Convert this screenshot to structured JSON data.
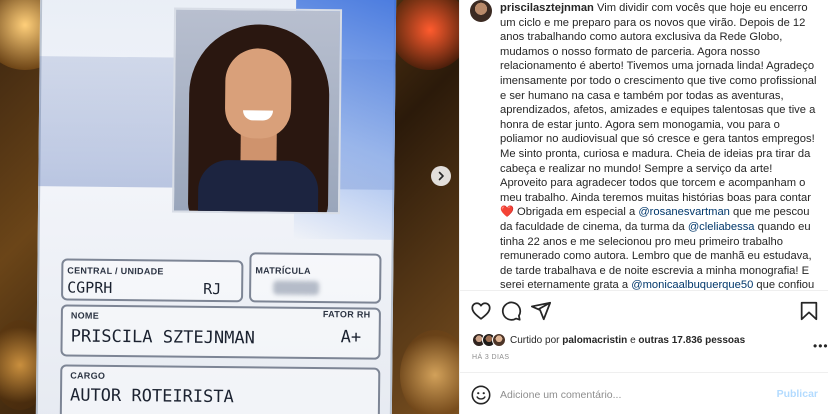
{
  "card": {
    "label_central": "CENTRAL / UNIDADE",
    "label_matricula": "MATRÍCULA",
    "value_central": "CGPRH",
    "value_state": "RJ",
    "label_nome": "NOME",
    "label_fator": "FATOR RH",
    "value_nome": "PRISCILA SZTEJNMAN",
    "value_fator": "A+",
    "label_cargo": "CARGO",
    "value_cargo": "AUTOR ROTEIRISTA"
  },
  "post": {
    "username": "priscilasztejnman",
    "caption_parts": {
      "p1": " Vim dividir com vocês que hoje eu encerro um ciclo e me preparo para os novos que virão. Depois de 12 anos trabalhando como autora exclusiva da Rede Globo, mudamos o nosso formato de parceria. Agora nosso relacionamento é aberto! Tivemos uma jornada linda! Agradeço imensamente por todo o crescimento que tive como profissional e ser humano na casa e também por todas as aventuras, aprendizados, afetos, amizades e equipes talentosas que tive a honra de estar junto. Agora sem monogamia, vou para o poliamor no audiovisual que só cresce e gera tantos empregos! Me sinto pronta, curiosa e madura. Cheia de ideias pra tirar da cabeça e realizar no mundo! Sempre a serviço da arte! Aproveito para agradecer todos que torcem e acompanham o meu trabalho. Ainda teremos muitas histórias boas para contar ",
      "heart": "❤️",
      "p2": " Obrigada em especial a ",
      "mention1": "@rosanesvartman",
      "p3": " que me pescou da faculdade de cinema, da turma da ",
      "mention2": "@cleliabessa",
      "p4": " quando eu tinha 22 anos e me selecionou pro meu primeiro trabalho remunerado como autora. Lembro que de manhã eu estudava, de tarde trabalhava e de noite escrevia a minha monografia! E serei eternamente grata a ",
      "mention3": "@monicaalbuquerque50",
      "p5": " que confiou em me promover a autora titular depois que apresentei minhas ideias originais. Ela sempre me incentivou mesmo sabendo os desafios que uma autora com vida real e imaginação criativa tem. Todos"
    },
    "likes_prefix": "Curtido por",
    "likes_user": "palomacristin",
    "likes_mid": "e",
    "likes_count": "outras 17.836 pessoas",
    "time": "HÁ 3 DIAS",
    "comment_placeholder": "Adicione um comentário...",
    "publish_label": "Publicar"
  },
  "icons": {
    "heart": "heart-icon",
    "comment": "comment-icon",
    "share": "share-icon",
    "save": "bookmark-icon",
    "emoji": "emoji-icon",
    "next": "chevron-right-icon",
    "more": "more-icon"
  },
  "colors": {
    "mention": "#00376b",
    "publish": "#b3dbff",
    "muted": "#8e8e8e"
  }
}
